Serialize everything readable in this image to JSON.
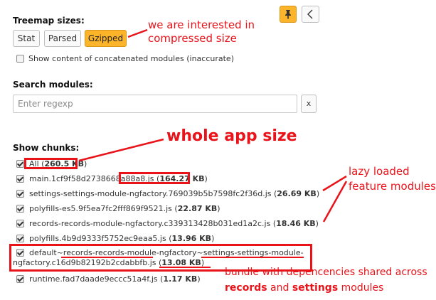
{
  "treemap": {
    "title": "Treemap sizes:",
    "buttons": [
      {
        "label": "Stat",
        "active": false
      },
      {
        "label": "Parsed",
        "active": false
      },
      {
        "label": "Gzipped",
        "active": true
      }
    ],
    "concat_label": "Show content of concatenated modules (inaccurate)"
  },
  "toolbar": {
    "pin_icon": "pin-icon",
    "back_icon": "chevron-left-icon"
  },
  "search": {
    "title": "Search modules:",
    "placeholder": "Enter regexp",
    "clear_label": "x"
  },
  "chunks": {
    "title": "Show chunks:",
    "items": [
      {
        "name": "All",
        "size": "260.5 KB",
        "checked": true
      },
      {
        "name": "main.1cf9f58d2738668a88a8.js",
        "size": "164.27 KB",
        "checked": true
      },
      {
        "name": "settings-settings-module-ngfactory.769039b5b7598fc2f36d.js",
        "size": "26.69 KB",
        "checked": true
      },
      {
        "name": "polyfills-es5.9f5ea7fc2fff869f9521.js",
        "size": "22.87 KB",
        "checked": true
      },
      {
        "name": "records-records-module-ngfactory.c339313428b031ed1a2c.js",
        "size": "18.46 KB",
        "checked": true
      },
      {
        "name": "polyfills.4b9d9333f5752ec9eaa5.js",
        "size": "13.96 KB",
        "checked": true
      },
      {
        "name_line1": "default~records-records-module-ngfactory~settings-settings-module-",
        "name_line2": "ngfactory.c16d9b82192b2cdabbfb.js",
        "size": "13.08 KB",
        "checked": true
      },
      {
        "name": "runtime.fad7daade9eccc51a4f.js",
        "size": "1.17 KB",
        "checked": true
      }
    ]
  },
  "annotations": {
    "compressed": [
      "we are interested in",
      "compressed size"
    ],
    "whole_app": "whole app size",
    "lazy": [
      "lazy loaded",
      "feature modules"
    ],
    "bundle_line1": "bundle with depencencies shared across",
    "bundle_records": "records",
    "bundle_and": " and ",
    "bundle_settings": "settings",
    "bundle_modules": " modules",
    "color": "#e8141a"
  },
  "colors": {
    "accent": "#fcb42a"
  }
}
